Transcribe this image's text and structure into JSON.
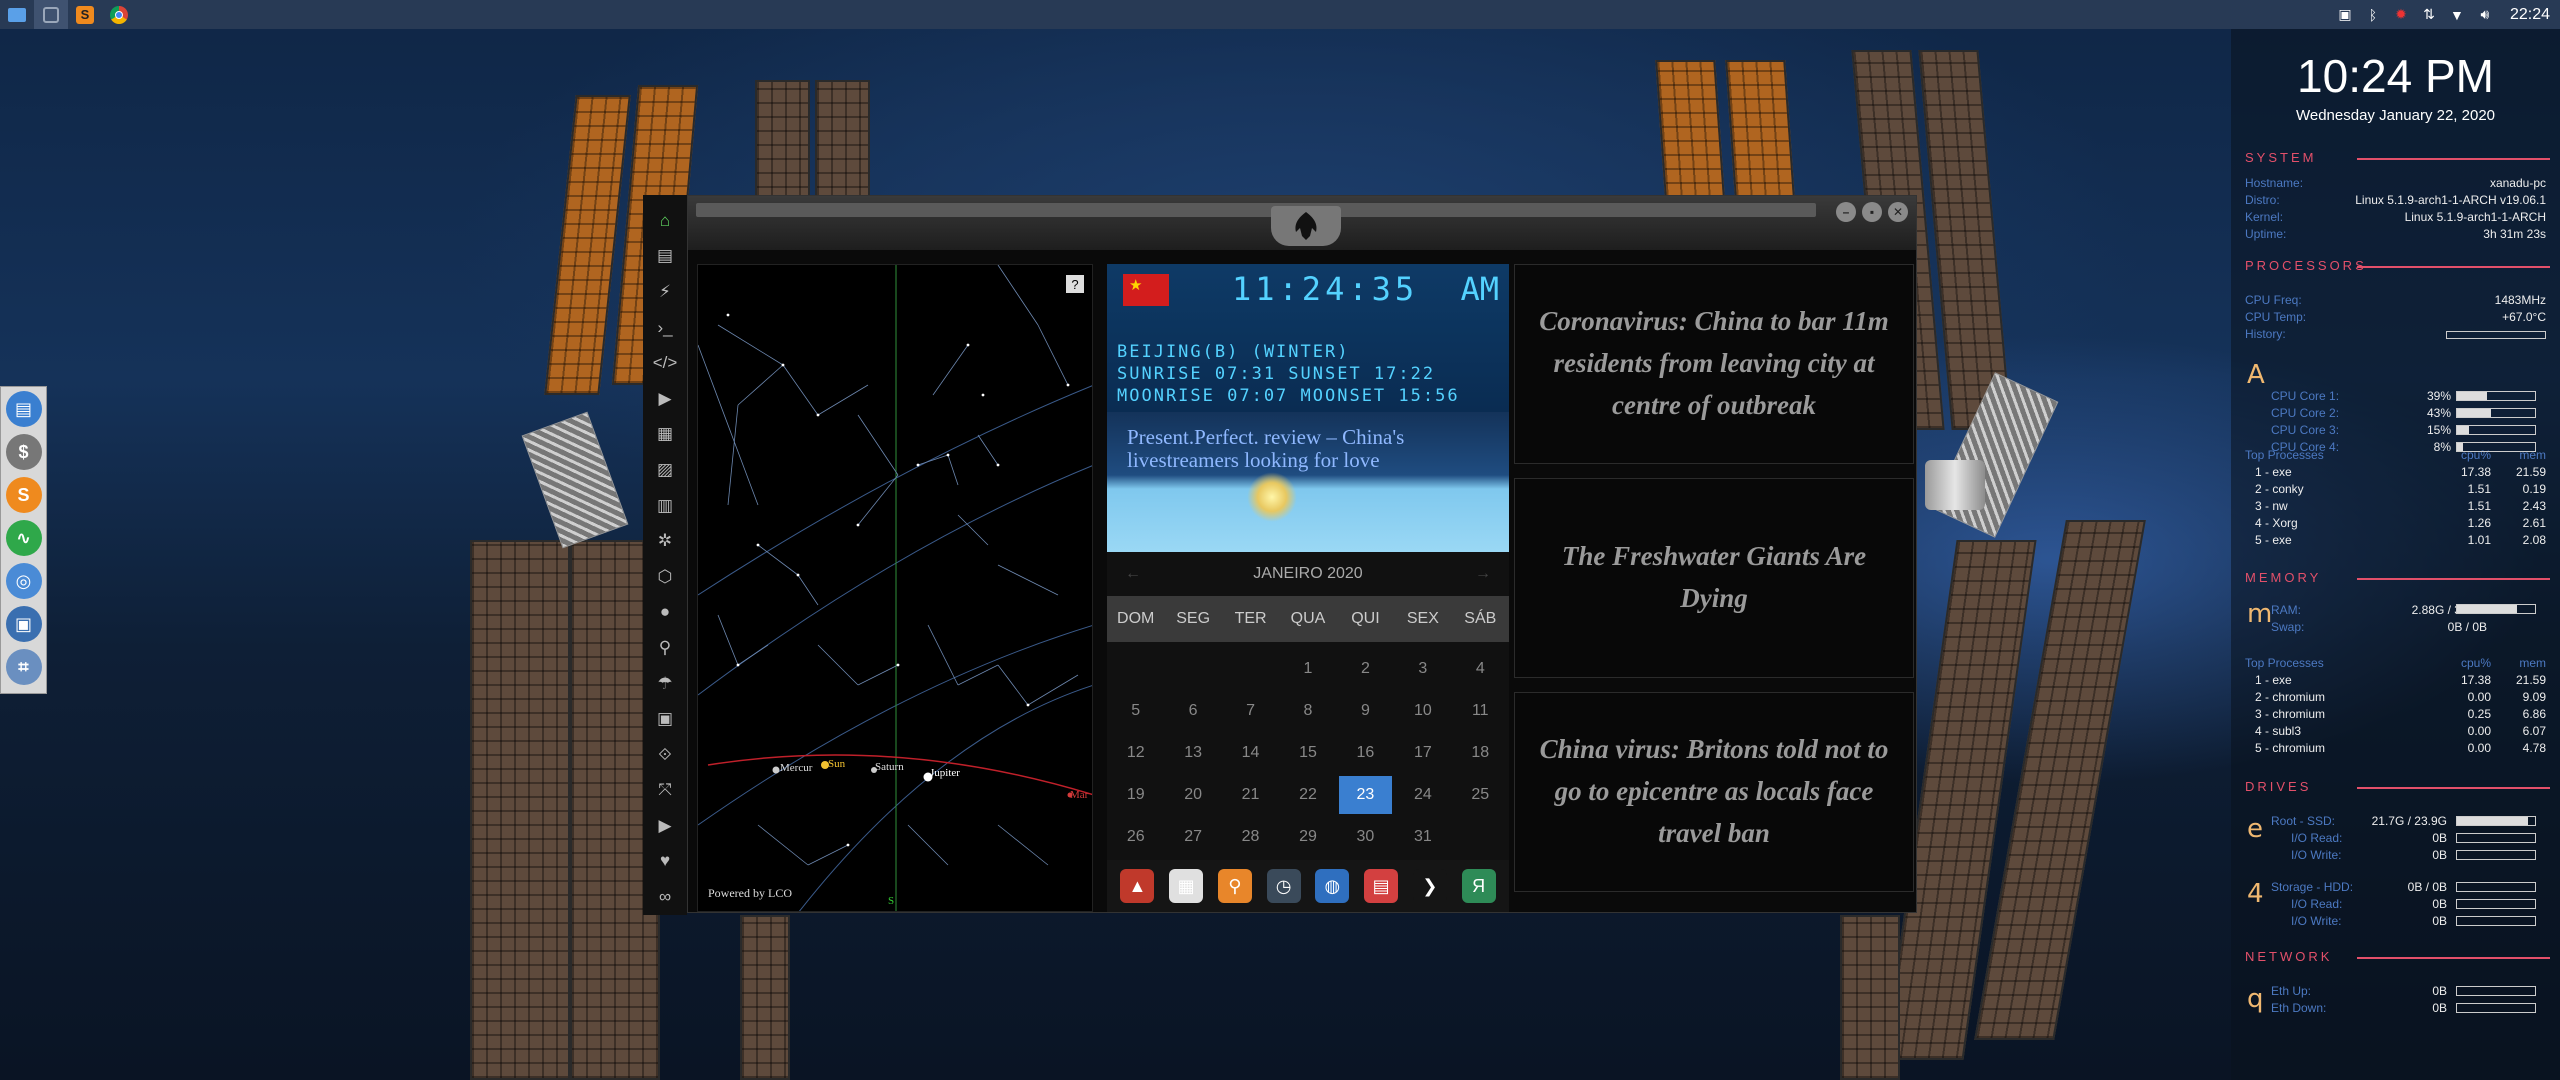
{
  "topbar": {
    "launchers": [
      "files-icon",
      "square-icon",
      "sublime-icon",
      "chrome-icon"
    ],
    "tray_icons": [
      "screen-icon",
      "bluetooth-icon",
      "bug-icon",
      "network-icon",
      "wifi-icon",
      "volume-icon"
    ],
    "clock": "22:24"
  },
  "dock": {
    "items": [
      {
        "icon": "files-icon",
        "color": "#3a7fd0",
        "glyph": "▤"
      },
      {
        "icon": "money-icon",
        "color": "#777777",
        "glyph": "$"
      },
      {
        "icon": "sublime-icon",
        "color": "#ef8a1e",
        "glyph": "S"
      },
      {
        "icon": "activity-icon",
        "color": "#2fa84a",
        "glyph": "∿"
      },
      {
        "icon": "chrome-icon",
        "color": "#4a8bd6",
        "glyph": "◎"
      },
      {
        "icon": "screenshot-icon",
        "color": "#3a6fb0",
        "glyph": "▣"
      },
      {
        "icon": "grid-icon",
        "color": "#6a8fc0",
        "glyph": "⌗"
      }
    ]
  },
  "sidebar": {
    "icons": [
      "home-icon",
      "file-icon",
      "bolt-icon",
      "terminal-icon",
      "code-icon",
      "play-icon",
      "document-icon",
      "image-icon",
      "news-icon",
      "settings-icon",
      "hexagon-icon",
      "globe-icon",
      "search-icon",
      "umbrella-icon",
      "contact-icon",
      "tag-icon",
      "expand-icon",
      "youtube-icon",
      "heart-icon",
      "link-icon"
    ],
    "glyphs": [
      "⌂",
      "▤",
      "⚡",
      "›_",
      "</>",
      "▶",
      "▦",
      "▨",
      "▥",
      "✲",
      "⬡",
      "●",
      "⚲",
      "☂",
      "▣",
      "⟐",
      "⤧",
      "▶",
      "♥",
      "∞"
    ]
  },
  "skymap": {
    "help": "?",
    "powered": "Powered by LCO",
    "planets": [
      {
        "name": "Mercury",
        "label": "Mercur",
        "color": "#cccccc"
      },
      {
        "name": "Sun",
        "label": "Sun",
        "color": "#f2c230"
      },
      {
        "name": "Saturn",
        "label": "Saturn",
        "color": "#cccccc"
      },
      {
        "name": "Jupiter",
        "label": "Jupiter",
        "color": "#ffffff"
      },
      {
        "name": "Mars",
        "label": "Mar",
        "color": "#d43a3a"
      }
    ],
    "south_marker": "S"
  },
  "worldclock": {
    "time": "11:24:35",
    "ampm": "AM",
    "city": "BEIJING(B) (WINTER)",
    "sun": "SUNRISE  07:31 SUNSET  17:22",
    "moon": "MOONRISE 07:07 MOONSET 15:56"
  },
  "news_image": {
    "caption": "Present.Perfect. review – China's livestreamers looking for love"
  },
  "calendar": {
    "month": "JANEIRO 2020",
    "prev": "←",
    "next": "→",
    "days": [
      "DOM",
      "SEG",
      "TER",
      "QUA",
      "QUI",
      "SEX",
      "SÁB"
    ],
    "cells": [
      "",
      "",
      "",
      "1",
      "2",
      "3",
      "4",
      "5",
      "6",
      "7",
      "8",
      "9",
      "10",
      "11",
      "12",
      "13",
      "14",
      "15",
      "16",
      "17",
      "18",
      "19",
      "20",
      "21",
      "22",
      "23",
      "24",
      "25",
      "26",
      "27",
      "28",
      "29",
      "30",
      "31",
      "",
      ""
    ],
    "today": "23"
  },
  "app_tray": [
    {
      "icon": "triangle-app-icon",
      "color": "#c0392b",
      "glyph": "▲"
    },
    {
      "icon": "calendar-app-icon",
      "color": "#e0e0e0",
      "glyph": "▦"
    },
    {
      "icon": "search-app-icon",
      "color": "#e8862a",
      "glyph": "⚲"
    },
    {
      "icon": "clock-app-icon",
      "color": "#3a4a5a",
      "glyph": "◷"
    },
    {
      "icon": "globe-app-icon",
      "color": "#2f6fbf",
      "glyph": "◍"
    },
    {
      "icon": "schedule-app-icon",
      "color": "#d34040",
      "glyph": "▤"
    },
    {
      "icon": "arrow-app-icon",
      "color": "#151515",
      "glyph": "❯"
    },
    {
      "icon": "yandex-app-icon",
      "color": "#2e8b57",
      "glyph": "Я"
    }
  ],
  "news": [
    "Coronavirus: China to bar 11m residents from leaving city at centre of outbreak",
    "The Freshwater Giants Are Dying",
    "China virus: Britons told not to go to epicentre as locals face travel ban"
  ],
  "conky": {
    "clock": "10:24 PM",
    "date": "Wednesday January 22, 2020",
    "system": {
      "title": "SYSTEM",
      "rows": [
        {
          "k": "Hostname:",
          "v": "xanadu-pc"
        },
        {
          "k": "Distro:",
          "v": "Linux 5.1.9-arch1-1-ARCH v19.06.1"
        },
        {
          "k": "Kernel:",
          "v": "Linux 5.1.9-arch1-1-ARCH"
        },
        {
          "k": "Uptime:",
          "v": "3h 31m 23s"
        }
      ]
    },
    "processors": {
      "title": "PROCESSORS",
      "freq": {
        "k": "CPU Freq:",
        "v": "1483MHz"
      },
      "temp": {
        "k": "CPU Temp:",
        "v": "+67.0°C"
      },
      "history": {
        "k": "History:"
      },
      "letter": "A",
      "cores": [
        {
          "k": "CPU Core 1:",
          "v": "39%",
          "pct": 39
        },
        {
          "k": "CPU Core 2:",
          "v": "43%",
          "pct": 43
        },
        {
          "k": "CPU Core 3:",
          "v": "15%",
          "pct": 15
        },
        {
          "k": "CPU Core 4:",
          "v": "8%",
          "pct": 8
        }
      ],
      "top_label": "Top Processes",
      "cpu_label": "cpu%",
      "mem_label": "mem",
      "top": [
        {
          "n": "1 - exe",
          "c": "17.38",
          "m": "21.59"
        },
        {
          "n": "2 - conky",
          "c": "1.51",
          "m": "0.19"
        },
        {
          "n": "3 - nw",
          "c": "1.51",
          "m": "2.43"
        },
        {
          "n": "4 - Xorg",
          "c": "1.26",
          "m": "2.61"
        },
        {
          "n": "5 - exe",
          "c": "1.01",
          "m": "2.08"
        }
      ]
    },
    "memory": {
      "title": "MEMORY",
      "letter": "m",
      "ram": {
        "k": "RAM:",
        "v": "2.88G / 3.76G",
        "pct": 77
      },
      "swap": {
        "k": "Swap:",
        "v": "0B / 0B",
        "pct": 0
      },
      "top_label": "Top Processes",
      "cpu_label": "cpu%",
      "mem_label": "mem",
      "top": [
        {
          "n": "1 - exe",
          "c": "17.38",
          "m": "21.59"
        },
        {
          "n": "2 - chromium",
          "c": "0.00",
          "m": "9.09"
        },
        {
          "n": "3 - chromium",
          "c": "0.25",
          "m": "6.86"
        },
        {
          "n": "4 - subl3",
          "c": "0.00",
          "m": "6.07"
        },
        {
          "n": "5 - chromium",
          "c": "0.00",
          "m": "4.78"
        }
      ]
    },
    "drives": {
      "title": "DRIVES",
      "root": {
        "letter": "e",
        "k": "Root  -  SSD:",
        "v": "21.7G / 23.9G",
        "pct": 91,
        "read_k": "I/O Read:",
        "read_v": "0B",
        "write_k": "I/O Write:",
        "write_v": "0B"
      },
      "storage": {
        "letter": "4",
        "k": "Storage  -  HDD:",
        "v": "0B / 0B",
        "pct": 0,
        "read_k": "I/O Read:",
        "read_v": "0B",
        "write_k": "I/O Write:",
        "write_v": "0B"
      }
    },
    "network": {
      "title": "NETWORK",
      "letter": "q",
      "up": {
        "k": "Eth Up:",
        "v": "0B"
      },
      "down": {
        "k": "Eth Down:",
        "v": "0B"
      }
    }
  }
}
